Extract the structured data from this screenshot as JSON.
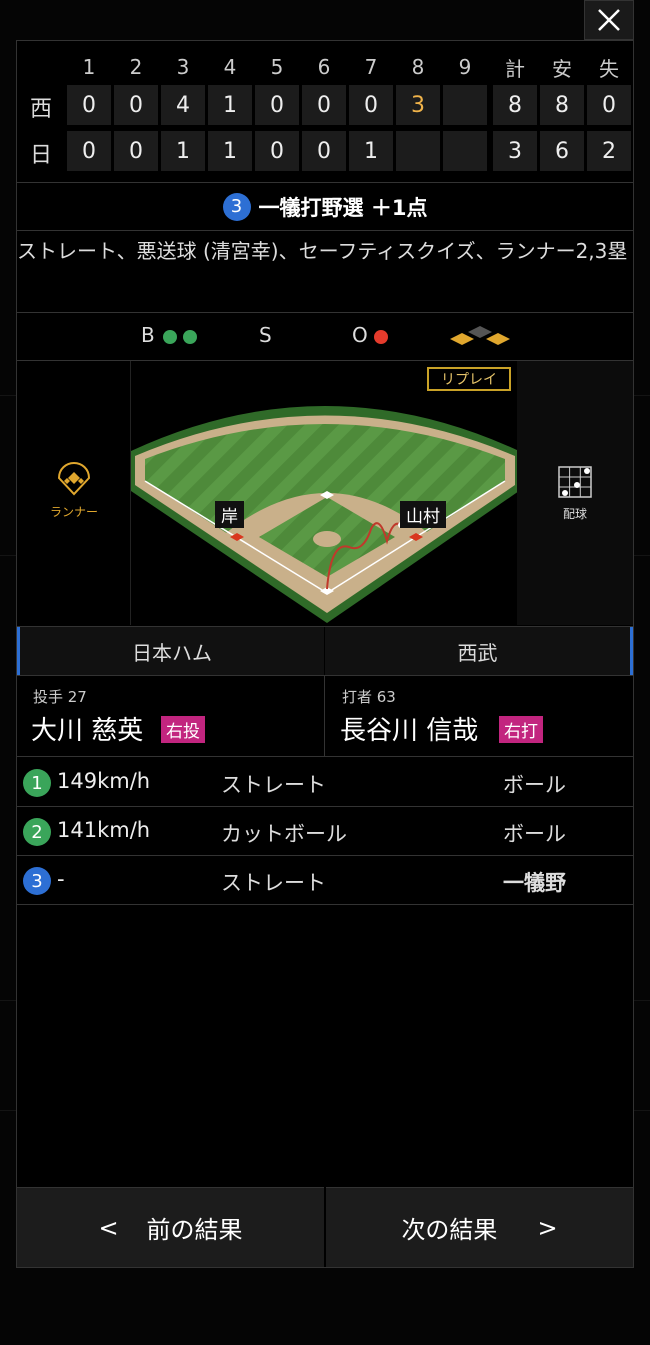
{
  "scoreboard": {
    "innings": [
      "1",
      "2",
      "3",
      "4",
      "5",
      "6",
      "7",
      "8",
      "9"
    ],
    "totals_headers": [
      "計",
      "安",
      "失"
    ],
    "teams": [
      {
        "name": "西",
        "scores": [
          "0",
          "0",
          "4",
          "1",
          "0",
          "0",
          "0",
          "3",
          ""
        ],
        "totals": [
          "8",
          "8",
          "0"
        ]
      },
      {
        "name": "日",
        "scores": [
          "0",
          "0",
          "1",
          "1",
          "0",
          "0",
          "1",
          "",
          ""
        ],
        "totals": [
          "3",
          "6",
          "2"
        ]
      }
    ]
  },
  "play": {
    "number": "3",
    "title": "一犠打野選 ＋1点",
    "description": "ストレート、悪送球 (清宮幸)、セーフティスクイズ、ランナー2,3塁"
  },
  "count": {
    "b_label": "B",
    "s_label": "S",
    "o_label": "O",
    "balls": 2,
    "strikes": 0,
    "outs": 1
  },
  "field": {
    "replay_label": "リプレイ",
    "runner_label": "ランナー",
    "pitch_label": "配球",
    "fielder_left": "岸",
    "fielder_right": "山村"
  },
  "tabs": {
    "home": "日本ハム",
    "away": "西武"
  },
  "pitcher": {
    "role": "投手 27",
    "name": "大川 慈英",
    "hand": "右投"
  },
  "batter": {
    "role": "打者 63",
    "name": "長谷川 信哉",
    "hand": "右打"
  },
  "pitches": [
    {
      "n": "1",
      "speed": "149km/h",
      "type": "ストレート",
      "result": "ボール",
      "color": "#3aa55a"
    },
    {
      "n": "2",
      "speed": "141km/h",
      "type": "カットボール",
      "result": "ボール",
      "color": "#3aa55a"
    },
    {
      "n": "3",
      "speed": "-",
      "type": "ストレート",
      "result": "一犠野",
      "color": "#2d6fd4"
    }
  ],
  "footer": {
    "prev": "前の結果",
    "next": "次の結果",
    "prev_arrow": "<",
    "next_arrow": ">"
  },
  "colors": {
    "ball": "#3aa55a",
    "out": "#e53b2c",
    "accent": "#c9a227",
    "hand_badge": "#c2257f"
  }
}
